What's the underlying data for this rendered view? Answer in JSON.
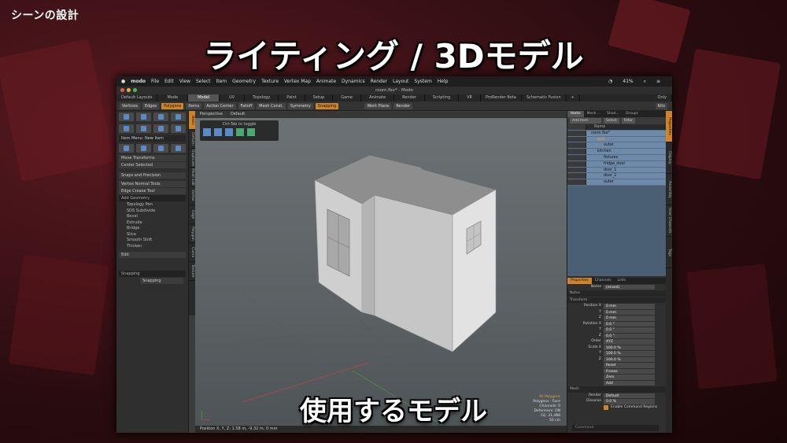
{
  "slide": {
    "label": "シーンの設計",
    "title": "ライティング / 3Dモデル",
    "subtitle": "使用するモデル"
  },
  "mac_menu": [
    "modo",
    "File",
    "Edit",
    "View",
    "Select",
    "Item",
    "Geometry",
    "Texture",
    "Vertex Map",
    "Animate",
    "Dynamics",
    "Render",
    "Layout",
    "System",
    "Help"
  ],
  "mac_status": {
    "battery": "41%"
  },
  "window_title": "room.fbx* - Modo",
  "layout_tabs": [
    "Default Layouts",
    "Mode",
    "Model",
    "UV",
    "Topology",
    "Paint",
    "Setup",
    "Game",
    "Animate",
    "Render",
    "Scripting",
    "VR",
    "ProRender Beta",
    "Schematic Fusion",
    "+",
    "Only"
  ],
  "active_layout_tab": "Model",
  "toolbar": [
    "Vertices",
    "Edges",
    "Polygons",
    "Items",
    "Action Center",
    "Falloff",
    "Mesh Const.",
    "Symmetry",
    "Snapping",
    "Work Plane",
    "Render",
    "Kits"
  ],
  "left_panel": {
    "item_menu": "Item Menu: New Item",
    "transforms": "Move Transforms",
    "center": "Center Selected",
    "snaps": "Snaps and Precision",
    "vertex_normal": "Vertex Normal Tools",
    "edge_crease": "Edge Crease Tool",
    "add_geometry": "Add Geometry",
    "tools": [
      "Topology Pen",
      "SDS Subdivide",
      "Bevel",
      "Extrude",
      "Bridge",
      "Slice",
      "Smooth Shift",
      "Thicken"
    ],
    "edit": "Edit",
    "snapping_hdr": "Snapping",
    "snapping_val": "Snapping",
    "vtabs": [
      "Basic",
      "Deform",
      "Duplicate",
      "Mesh Edit",
      "Vertex",
      "Edge",
      "Polygon",
      "Curve",
      "Texture"
    ]
  },
  "viewport": {
    "view": "Perspective",
    "mode": "Default",
    "tip": "Ctrl-Tab to toggle",
    "info": [
      "All Polygons",
      "Polygons : Face",
      "Channels: 0",
      "Deformers: ON",
      "GL: 31,488",
      "50 cm"
    ],
    "status": "Position X, Y, Z:  1.58 m, -9.32 m, 0 mm"
  },
  "right_panel": {
    "tabs": [
      "Items",
      "Mesh ...",
      "Shad...",
      "Groups"
    ],
    "add_item": "Add Item",
    "select": "Select",
    "filter": "Filter",
    "name_col": "Name",
    "items": [
      {
        "name": "room.fbx*",
        "indent": 0
      },
      {
        "name": "wall",
        "indent": 1
      },
      {
        "name": "outer",
        "indent": 2
      },
      {
        "name": "kitchen",
        "indent": 1
      },
      {
        "name": "fixtures",
        "indent": 2
      },
      {
        "name": "fridge_door",
        "indent": 2
      },
      {
        "name": "door_1",
        "indent": 2
      },
      {
        "name": "door_2",
        "indent": 2
      },
      {
        "name": "outer",
        "indent": 2
      }
    ],
    "prop_tabs": [
      "Properties",
      "Channels",
      "Lists"
    ],
    "name_label": "Name",
    "name_value": "(mixed)",
    "sections": {
      "notes": "Notes",
      "transform": "Transform",
      "mesh": "Mesh"
    },
    "position": [
      "0 mm",
      "0 mm",
      "0 mm"
    ],
    "rotation": [
      "0.0 °",
      "0.0 °",
      "0.0 °"
    ],
    "order": "XYZ",
    "scale": [
      "100.0 %",
      "100.0 %",
      "100.0 %"
    ],
    "actions": [
      "Reset",
      "Freeze",
      "Zero",
      "Add"
    ],
    "render_label": "Render",
    "render_value": "Default",
    "dissolve_label": "Dissolve",
    "dissolve_value": "0.0 %",
    "combined": "Enable Command Regions",
    "command": "Command",
    "rvtabs": [
      "Properties",
      "Display",
      "Assembly",
      "User Channels",
      "Tags"
    ]
  }
}
